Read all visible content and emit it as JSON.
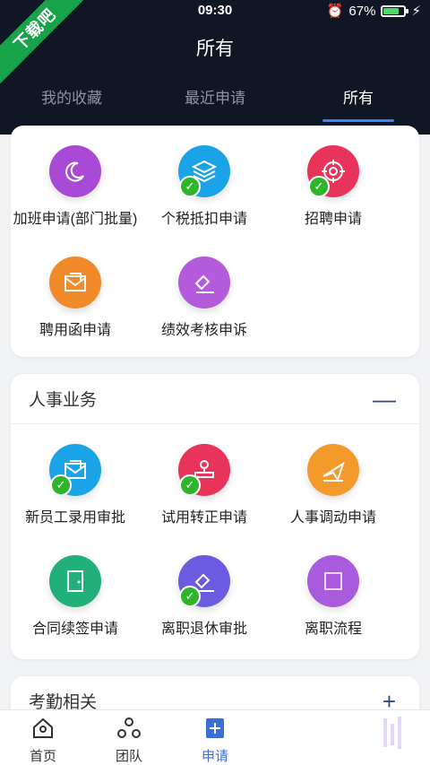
{
  "status": {
    "time": "09:30",
    "battery_text": "67%",
    "battery_level": 0.67
  },
  "watermark": "下载吧",
  "header": {
    "title": "所有"
  },
  "tabs": [
    {
      "label": "我的收藏"
    },
    {
      "label": "最近申请"
    },
    {
      "label": "所有"
    }
  ],
  "section1": {
    "items": [
      {
        "label": "加班申请(部门批量)",
        "icon": "moon-icon",
        "color": "#a84ad6",
        "checked": false
      },
      {
        "label": "个税抵扣申请",
        "icon": "layers-icon",
        "color": "#1aa3e6",
        "checked": true
      },
      {
        "label": "招聘申请",
        "icon": "target-icon",
        "color": "#e8335a",
        "checked": true
      },
      {
        "label": "聘用函申请",
        "icon": "envelope-icon",
        "color": "#f08a2a",
        "checked": false
      },
      {
        "label": "绩效考核申诉",
        "icon": "hammer-icon",
        "color": "#b45bdc",
        "checked": false
      }
    ]
  },
  "section2": {
    "title": "人事业务",
    "toggle": "—",
    "items": [
      {
        "label": "新员工录用审批",
        "icon": "envelope-icon",
        "color": "#1aa3e6",
        "checked": true
      },
      {
        "label": "试用转正申请",
        "icon": "stamp-icon",
        "color": "#e8335a",
        "checked": true
      },
      {
        "label": "人事调动申请",
        "icon": "plane-icon",
        "color": "#f39a2b",
        "checked": false
      },
      {
        "label": "合同续签申请",
        "icon": "door-icon",
        "color": "#22b07a",
        "checked": false
      },
      {
        "label": "离职退休审批",
        "icon": "hammer-icon",
        "color": "#6a5be0",
        "checked": true
      },
      {
        "label": "离职流程",
        "icon": "square-icon",
        "color": "#a85bdc",
        "checked": false
      }
    ]
  },
  "section3": {
    "title": "考勤相关",
    "toggle": "+"
  },
  "bottom_nav": [
    {
      "label": "首页",
      "icon": "home-icon"
    },
    {
      "label": "团队",
      "icon": "team-icon"
    },
    {
      "label": "申请",
      "icon": "apply-icon"
    }
  ],
  "colors": {
    "header_bg": "#0f1724",
    "accent": "#3b82f6",
    "check": "#2fb52b"
  }
}
